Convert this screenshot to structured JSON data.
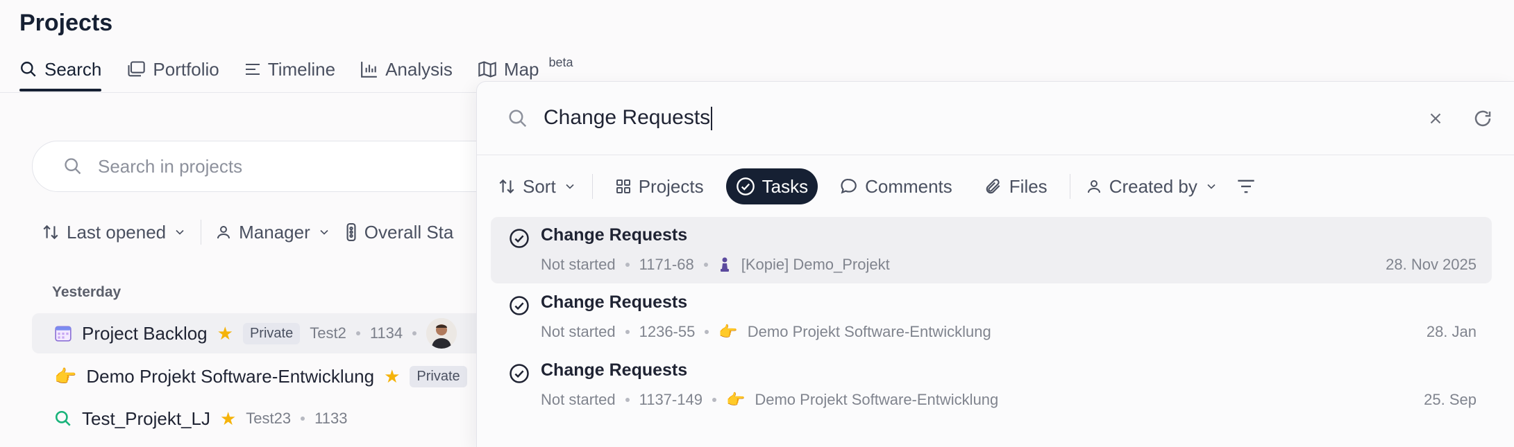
{
  "page": {
    "title": "Projects"
  },
  "tabs": [
    {
      "label": "Search",
      "icon": "search-icon",
      "active": true
    },
    {
      "label": "Portfolio",
      "icon": "portfolio-icon"
    },
    {
      "label": "Timeline",
      "icon": "timeline-icon"
    },
    {
      "label": "Analysis",
      "icon": "analysis-icon"
    },
    {
      "label": "Map",
      "icon": "map-icon",
      "sup": "beta"
    }
  ],
  "project_search": {
    "placeholder": "Search in projects"
  },
  "project_filters": {
    "sort_label": "Last opened",
    "manager_label": "Manager",
    "status_label": "Overall Sta"
  },
  "group": {
    "label": "Yesterday"
  },
  "projects": [
    {
      "name": "Project Backlog",
      "icon": "calendar-icon",
      "badge": "Private",
      "meta1": "Test2",
      "meta2": "1134"
    },
    {
      "name": "Demo Projekt Software-Entwicklung",
      "icon": "pointing-hand-icon",
      "badge": "Private"
    },
    {
      "name": "Test_Projekt_LJ",
      "icon": "search-icon",
      "meta1": "Test23",
      "meta2": "1133"
    }
  ],
  "overlay": {
    "query": "Change Requests",
    "filters": {
      "sort": "Sort",
      "projects": "Projects",
      "tasks": "Tasks",
      "comments": "Comments",
      "files": "Files",
      "created_by": "Created by"
    },
    "results": [
      {
        "title": "Change Requests",
        "status": "Not started",
        "id": "1171-68",
        "project": "[Kopie] Demo_Projekt",
        "project_icon": "chess-pawn-icon",
        "date": "28. Nov 2025"
      },
      {
        "title": "Change Requests",
        "status": "Not started",
        "id": "1236-55",
        "project": "Demo Projekt Software-Entwicklung",
        "project_icon": "pointing-hand-icon",
        "date": "28. Jan"
      },
      {
        "title": "Change Requests",
        "status": "Not started",
        "id": "1137-149",
        "project": "Demo Projekt Software-Entwicklung",
        "project_icon": "pointing-hand-icon",
        "date": "25. Sep"
      }
    ]
  },
  "colors": {
    "accent": "#162033",
    "star": "#f5b30a",
    "success": "#19b37a"
  }
}
